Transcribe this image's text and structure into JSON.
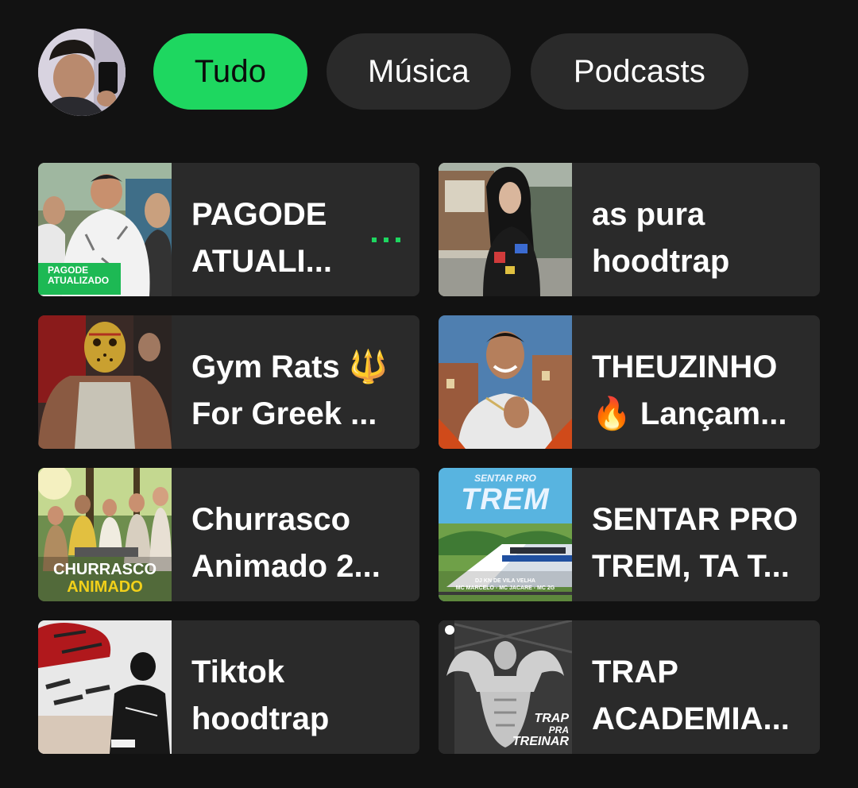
{
  "filters": {
    "items": [
      {
        "label": "Tudo",
        "active": true
      },
      {
        "label": "Música",
        "active": false
      },
      {
        "label": "Podcasts",
        "active": false
      }
    ],
    "active_color": "#1ed760",
    "inactive_color": "#2a2a2a"
  },
  "colors": {
    "background": "#121212",
    "tile_background": "#2a2a2a",
    "accent": "#1ed760",
    "text": "#ffffff"
  },
  "shortcuts": [
    {
      "title": "PAGODE\nATUALI...",
      "cover_text": [
        "PAGODE",
        "ATUALIZADO"
      ],
      "playing": true
    },
    {
      "title": "as pura\nhoodtrap"
    },
    {
      "title": "Gym Rats 🔱\nFor Greek ..."
    },
    {
      "title": "THEUZINHO\n🔥 Lançam..."
    },
    {
      "title": "Churrasco\nAnimado 2...",
      "cover_text": [
        "CHURRASCO",
        "ANIMADO"
      ]
    },
    {
      "title": "SENTAR PRO\nTREM, TA T...",
      "cover_text": [
        "SENTAR PRO",
        "TREM",
        "DJ KN DE VILA VELHA",
        "MC MARCELO - MC JACARE - MC 2G"
      ]
    },
    {
      "title": "Tiktok\nhoodtrap"
    },
    {
      "title": "TRAP\nACADEMIA...",
      "cover_text": [
        "TRAP",
        "PRA",
        "TREINAR"
      ]
    }
  ]
}
